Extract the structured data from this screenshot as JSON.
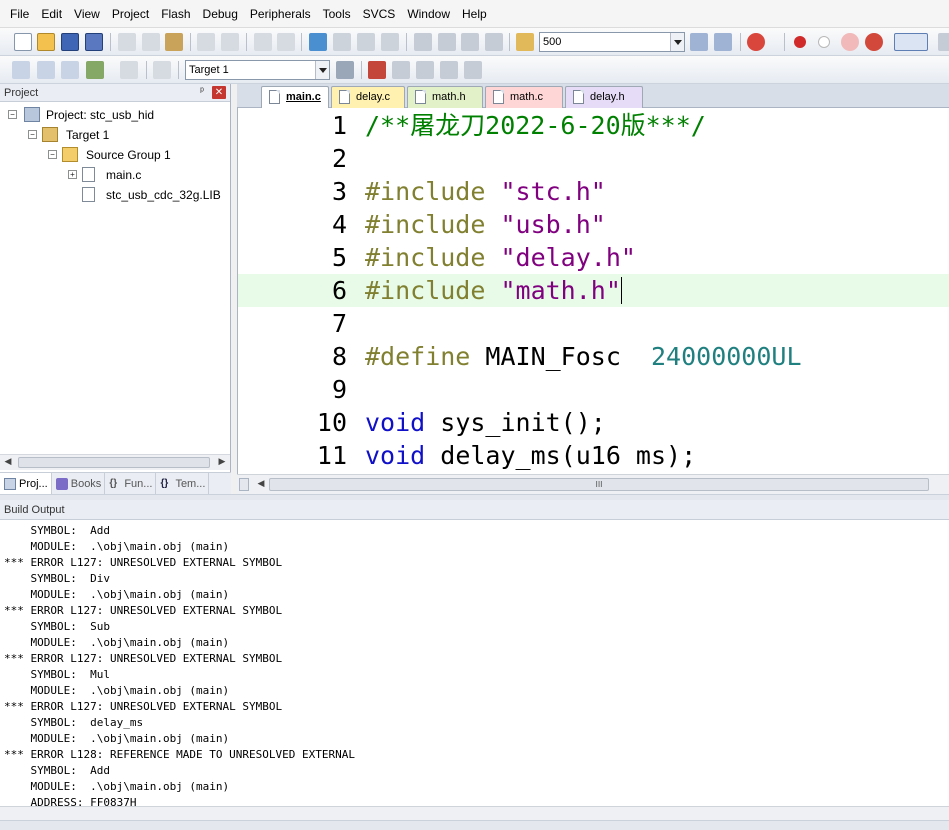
{
  "menu": [
    "File",
    "Edit",
    "View",
    "Project",
    "Flash",
    "Debug",
    "Peripherals",
    "Tools",
    "SVCS",
    "Window",
    "Help"
  ],
  "toolbar": {
    "find_value": "500",
    "target_value": "Target 1"
  },
  "project_panel": {
    "title": "Project",
    "pin": "ᵖ",
    "close": "✕",
    "tree": {
      "project": "Project: stc_usb_hid",
      "target": "Target 1",
      "group": "Source Group 1",
      "files": [
        "main.c",
        "stc_usb_cdc_32g.LIB"
      ]
    },
    "tabs": [
      "Proj...",
      "Books",
      "Fun...",
      "Tem..."
    ]
  },
  "editor": {
    "tabs": [
      {
        "label": "main.c",
        "active": true,
        "color": "#ffffff"
      },
      {
        "label": "delay.c",
        "active": false,
        "color": "#fff1b0"
      },
      {
        "label": "math.h",
        "active": false,
        "color": "#e3f1c8"
      },
      {
        "label": "math.c",
        "active": false,
        "color": "#ffd6d6"
      },
      {
        "label": "delay.h",
        "active": false,
        "color": "#e6dcf7"
      }
    ],
    "lines": [
      {
        "n": "1",
        "parts": [
          {
            "c": "c-cmt",
            "t": "/**屠龙刀2022-6-20版***/"
          }
        ]
      },
      {
        "n": "2",
        "parts": []
      },
      {
        "n": "3",
        "parts": [
          {
            "c": "c-pp",
            "t": "#include "
          },
          {
            "c": "c-str",
            "t": "\"stc.h\""
          }
        ]
      },
      {
        "n": "4",
        "parts": [
          {
            "c": "c-pp",
            "t": "#include "
          },
          {
            "c": "c-str",
            "t": "\"usb.h\""
          }
        ]
      },
      {
        "n": "5",
        "parts": [
          {
            "c": "c-pp",
            "t": "#include "
          },
          {
            "c": "c-str",
            "t": "\"delay.h\""
          }
        ]
      },
      {
        "n": "6",
        "parts": [
          {
            "c": "c-pp",
            "t": "#include "
          },
          {
            "c": "c-str",
            "t": "\"math.h\""
          }
        ],
        "highlight": true,
        "cursor": true
      },
      {
        "n": "7",
        "parts": []
      },
      {
        "n": "8",
        "parts": [
          {
            "c": "c-pp",
            "t": "#define "
          },
          {
            "c": "",
            "t": "MAIN_Fosc  "
          },
          {
            "c": "c-num",
            "t": "24000000UL"
          }
        ]
      },
      {
        "n": "9",
        "parts": []
      },
      {
        "n": "10",
        "parts": [
          {
            "c": "c-kw",
            "t": "void"
          },
          {
            "c": "",
            "t": " sys_init();"
          }
        ]
      },
      {
        "n": "11",
        "parts": [
          {
            "c": "c-kw",
            "t": "void"
          },
          {
            "c": "",
            "t": " delay_ms(u16 ms);"
          }
        ]
      }
    ],
    "scroll_grip": "III"
  },
  "build_output": {
    "title": "Build Output",
    "lines": [
      "    SYMBOL:  Add",
      "    MODULE:  .\\obj\\main.obj (main)",
      "*** ERROR L127: UNRESOLVED EXTERNAL SYMBOL",
      "    SYMBOL:  Div",
      "    MODULE:  .\\obj\\main.obj (main)",
      "*** ERROR L127: UNRESOLVED EXTERNAL SYMBOL",
      "    SYMBOL:  Sub",
      "    MODULE:  .\\obj\\main.obj (main)",
      "*** ERROR L127: UNRESOLVED EXTERNAL SYMBOL",
      "    SYMBOL:  Mul",
      "    MODULE:  .\\obj\\main.obj (main)",
      "*** ERROR L127: UNRESOLVED EXTERNAL SYMBOL",
      "    SYMBOL:  delay_ms",
      "    MODULE:  .\\obj\\main.obj (main)",
      "*** ERROR L128: REFERENCE MADE TO UNRESOLVED EXTERNAL",
      "    SYMBOL:  Add",
      "    MODULE:  .\\obj\\main.obj (main)",
      "    ADDRESS: FF0837H"
    ]
  }
}
